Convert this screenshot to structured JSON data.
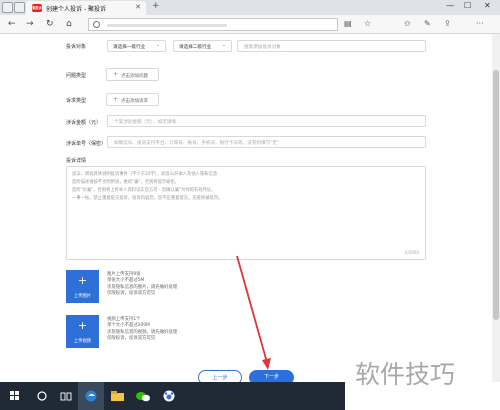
{
  "browser": {
    "tab_title": "创建个人投诉 - 聚投诉",
    "favicon_text": "聚投诉",
    "new_tab": "+",
    "back": "←",
    "forward": "→",
    "refresh": "↻",
    "home": "⌂"
  },
  "form": {
    "target_label": "投诉对象",
    "industry1": "请选择一级行业",
    "industry2": "请选择二级行业",
    "target_placeholder": "搜索添加投诉对象",
    "problem_label": "问题类型",
    "problem_btn": "点击添加问题",
    "demand_label": "诉求类型",
    "demand_btn": "点击添加诉求",
    "amount_label": "涉诉金额（元）",
    "amount_placeholder": "个案涉诉金额（元），如无请填",
    "order_label": "涉诉单号（保密）",
    "order_placeholder": "如微信号、投诉支付平台、订单号、账号、手机号、银行卡号等，没有则填写\"无\"",
    "detail_label": "投诉详情",
    "detail_hint_lines": [
      "说法、请说具体说明投诉事件（不少于20字），如含公开本人及他人隐私信息",
      "您所描述请按不文明用语，维权\"骗\"，否则将提示被拒。",
      "您所\"论骗\"，否则将上传本人资料证实您方可 - 您确认骗\"为你的有效凭证。",
      "一事一帖，禁止重复提交投诉，投诉内容后，您不应重复提交。违者将被处罚。"
    ],
    "detail_counter": "0/2000",
    "upload_image_btn": "上传图片",
    "upload_image_plus": "+",
    "upload_image_tips": [
      "图片上传支持9张",
      "单张大小不超过5M",
      "涉及隐私信息的图片，请先做好处理",
      "仅限投诉，投诉双方可见"
    ],
    "upload_video_btn": "上传视频",
    "upload_video_plus": "+",
    "upload_video_tips": [
      "视频上传支持1个",
      "单个大小不超过200M",
      "涉及隐私信息的视频，请先做好处理",
      "仅限投诉，投诉双方可见"
    ],
    "prev_btn": "上一步",
    "next_btn": "下一步"
  },
  "watermark": "软件技巧",
  "colors": {
    "primary": "#2c6fe0",
    "annotation_arrow": "#e0333a",
    "taskbar": "#1f2a36"
  }
}
